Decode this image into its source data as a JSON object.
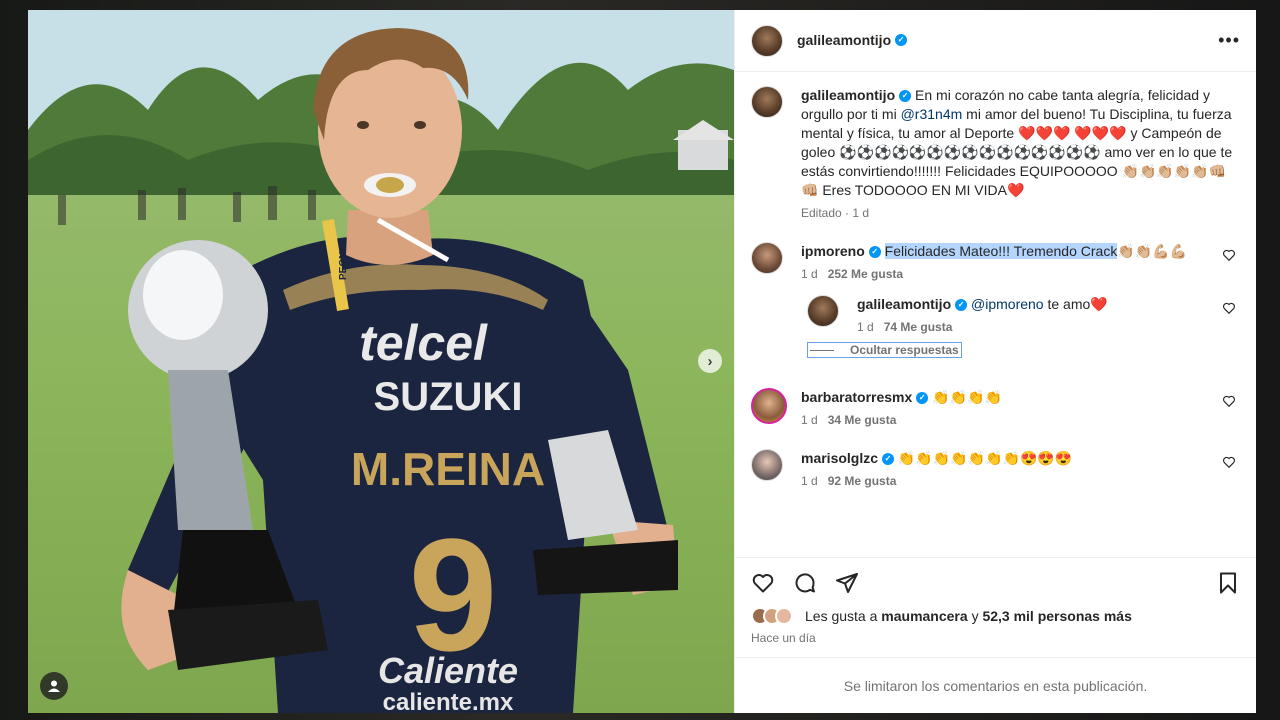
{
  "post": {
    "author": "galileamontijo",
    "caption": {
      "before_mention": "En mi corazón no cabe tanta alegría, felicidad y orgullo por ti mi ",
      "mention": "@r31n4m",
      "after_mention": " mi amor del bueno! Tu Disciplina, tu fuerza mental y física, tu amor al Deporte ❤️❤️❤️ ❤️❤️❤️ y Campeón de goleo ⚽⚽⚽⚽⚽⚽⚽⚽⚽⚽⚽⚽⚽⚽⚽ amo ver en lo que te estás convirtiendo!!!!!!! Felicidades EQUIPOOOOO 👏🏼👏🏼👏🏼👏🏼👏🏼👊🏼👊🏼 Eres TODOOOO EN MI VIDA❤️",
      "edited": "Editado",
      "time": "1 d"
    }
  },
  "photo": {
    "jersey_name": "M.REINA",
    "jersey_number": "9",
    "sponsor_1": "telcel",
    "sponsor_2": "SUZUKI",
    "sponsor_3": "Caliente",
    "sponsor_3_url": "caliente.mx",
    "lanyard": "PEON"
  },
  "comments": [
    {
      "user": "ipmoreno",
      "text": "Felicidades Mateo!!! Tremendo Crack",
      "emoji": "👏🏼👏🏼💪🏼💪🏼",
      "time": "1 d",
      "likes": "252 Me gusta",
      "replies": [
        {
          "user": "galileamontijo",
          "mention": "@ipmoreno",
          "text": " te amo❤️",
          "time": "1 d",
          "likes": "74 Me gusta"
        }
      ],
      "hide_replies_label": "Ocultar respuestas"
    },
    {
      "user": "barbaratorresmx",
      "text": "👏👏👏👏",
      "time": "1 d",
      "likes": "34 Me gusta"
    },
    {
      "user": "marisolglzc",
      "text": "👏👏👏👏👏👏👏😍😍😍",
      "time": "1 d",
      "likes": "92 Me gusta"
    }
  ],
  "likes": {
    "prefix": "Les gusta a ",
    "first_user": "maumancera",
    "middle": " y ",
    "others": "52,3 mil personas más"
  },
  "post_date": "Hace un día",
  "comments_limited": "Se limitaron los comentarios en esta publicación.",
  "colors": {
    "verified": "#0095f6",
    "heart": "#ed4956",
    "mention": "#00376b",
    "selection": "#b4d5fe"
  },
  "icons": [
    "more-icon",
    "heart-icon",
    "comment-icon",
    "share-icon",
    "bookmark-icon",
    "chevron-right-icon",
    "user-tag-icon",
    "verified-icon"
  ]
}
